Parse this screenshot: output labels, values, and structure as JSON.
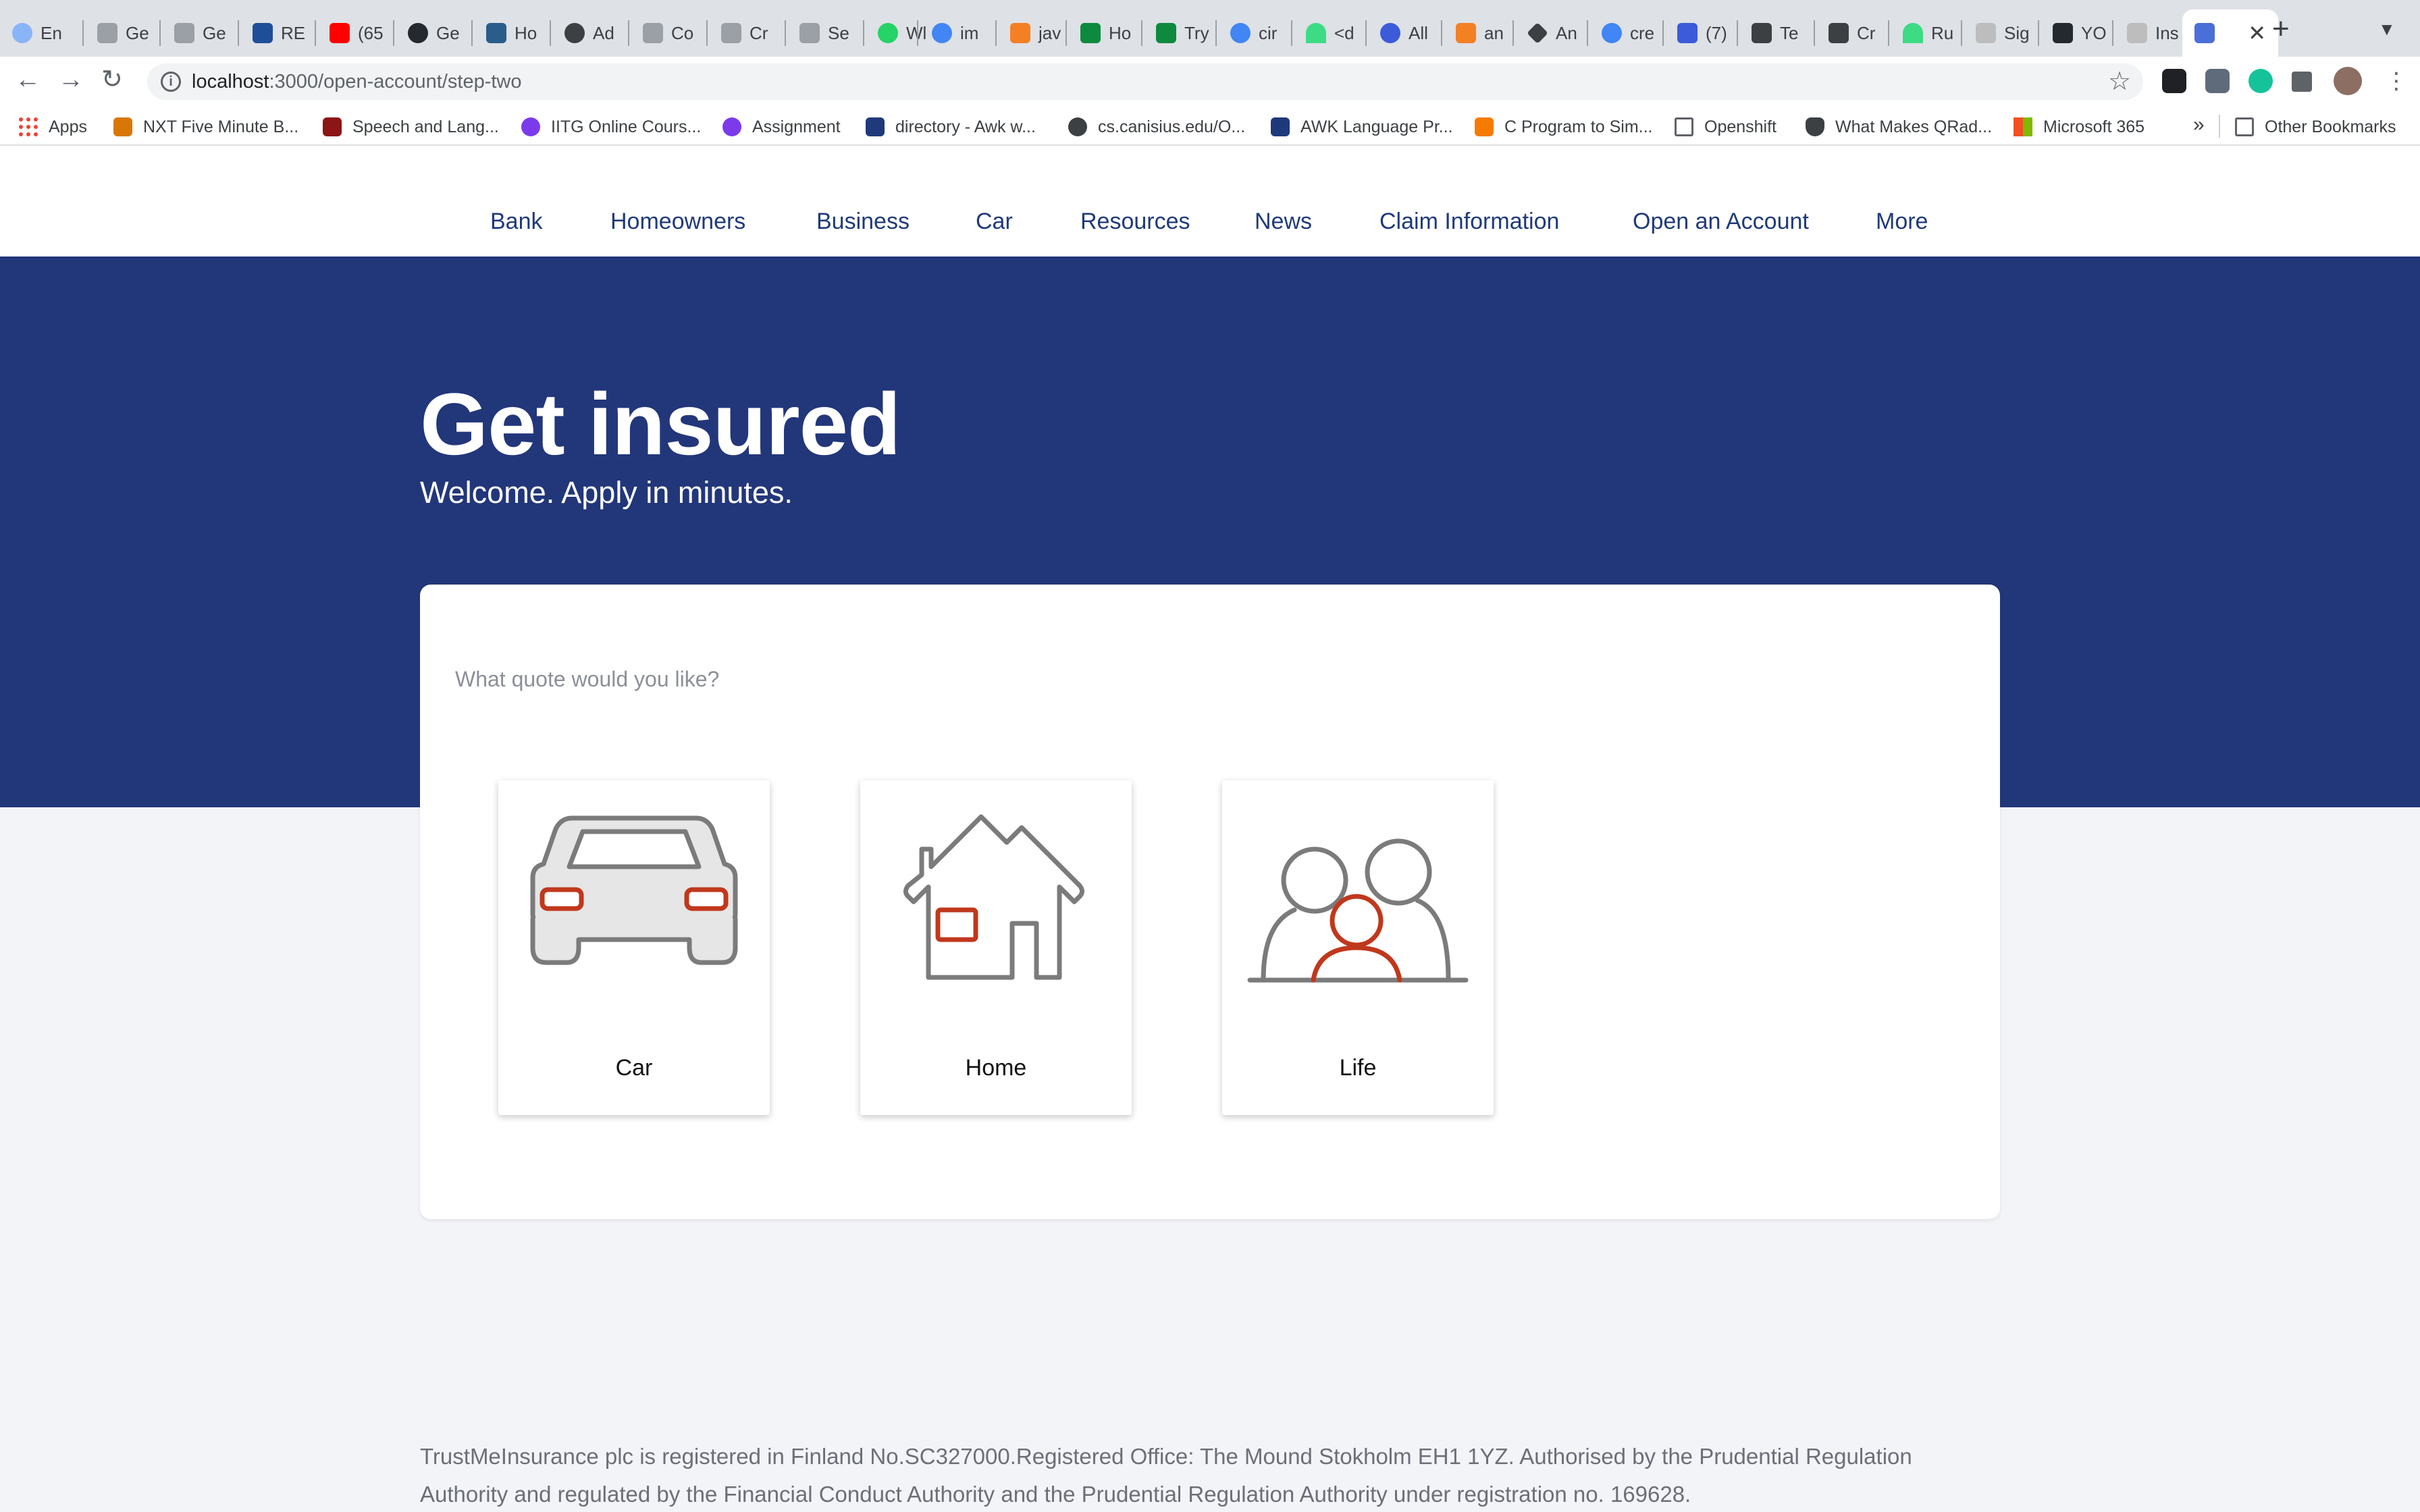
{
  "browser": {
    "tabs": [
      {
        "label": "En",
        "color": "#8ab4f8"
      },
      {
        "label": "Ge",
        "color": "#5f6368"
      },
      {
        "label": "Ge",
        "color": "#5f6368"
      },
      {
        "label": "RE",
        "color": "#1f4e99"
      },
      {
        "label": "(65",
        "color": "#ff0000"
      },
      {
        "label": "Ge",
        "color": "#24292f"
      },
      {
        "label": "Ho",
        "color": "#2a5d8a"
      },
      {
        "label": "Ad",
        "color": "#3c4043"
      },
      {
        "label": "Co",
        "color": "#5f6368"
      },
      {
        "label": "Cr",
        "color": "#5f6368"
      },
      {
        "label": "Se",
        "color": "#5f6368"
      },
      {
        "label": "Wl",
        "color": "#25d366"
      },
      {
        "label": "im",
        "color": "#4285f4"
      },
      {
        "label": "jav",
        "color": "#f48024"
      },
      {
        "label": "Ho",
        "color": "#0e8a3e"
      },
      {
        "label": "Try",
        "color": "#0e8a3e"
      },
      {
        "label": "cir",
        "color": "#4285f4"
      },
      {
        "label": "<d",
        "color": "#3ddc84"
      },
      {
        "label": "All",
        "color": "#3b5bdb"
      },
      {
        "label": "an",
        "color": "#f48024"
      },
      {
        "label": "An",
        "color": "#3c4043"
      },
      {
        "label": "cre",
        "color": "#4285f4"
      },
      {
        "label": "(7)",
        "color": "#3b5bdb"
      },
      {
        "label": "Te",
        "color": "#3c4043"
      },
      {
        "label": "Cr",
        "color": "#3c4043"
      },
      {
        "label": "Ru",
        "color": "#3ddc84"
      },
      {
        "label": "Sig",
        "color": "#bdbdbd"
      },
      {
        "label": "YO",
        "color": "#24292f"
      },
      {
        "label": "Ins",
        "color": "#bdbdbd"
      }
    ],
    "active_tab_color": "#4a6fd8",
    "url_host": "localhost",
    "url_path": ":3000/open-account/step-two",
    "bookmarks": [
      {
        "label": "Apps",
        "color": "#ea4335"
      },
      {
        "label": "NXT Five Minute B...",
        "color": "#d97706"
      },
      {
        "label": "Speech and Lang...",
        "color": "#8c1515"
      },
      {
        "label": "IITG Online Cours...",
        "color": "#7c3aed"
      },
      {
        "label": "Assignment",
        "color": "#7c3aed"
      },
      {
        "label": "directory - Awk w...",
        "color": "#1f3a7a"
      },
      {
        "label": "cs.canisius.edu/O...",
        "color": "#3c4043"
      },
      {
        "label": "AWK Language Pr...",
        "color": "#1f3a7a"
      },
      {
        "label": "C Program to Sim...",
        "color": "#f57c00"
      },
      {
        "label": "Openshift",
        "color": "#9aa0a6"
      },
      {
        "label": "What Makes QRad...",
        "color": "#3c4043"
      },
      {
        "label": "Microsoft 365",
        "color": "#f25022"
      }
    ],
    "bookmarks_overflow": "»",
    "other_bookmarks": "Other Bookmarks"
  },
  "site_nav": [
    "Bank",
    "Homeowners",
    "Business",
    "Car",
    "Resources",
    "News",
    "Claim Information",
    "Open an Account",
    "More"
  ],
  "hero": {
    "title": "Get insured",
    "subtitle": "Welcome. Apply in minutes."
  },
  "quote": {
    "prompt": "What quote would you like?",
    "options": [
      {
        "label": "Car",
        "icon": "car-icon"
      },
      {
        "label": "Home",
        "icon": "house-icon"
      },
      {
        "label": "Life",
        "icon": "family-icon"
      }
    ]
  },
  "footer": {
    "text": "TrustMeInsurance plc is registered in Finland No.SC327000.Registered Office: The Mound Stokholm EH1 1YZ. Authorised by the Prudential Regulation Authority and regulated by the Financial Conduct Authority and the Prudential Regulation Authority under registration no. 169628."
  },
  "colors": {
    "brand_navy": "#22367a",
    "nav_text": "#1f3a7a",
    "icon_gray": "#7b7b7b",
    "icon_accent": "#c0381c",
    "page_bg": "#f3f4f7"
  }
}
